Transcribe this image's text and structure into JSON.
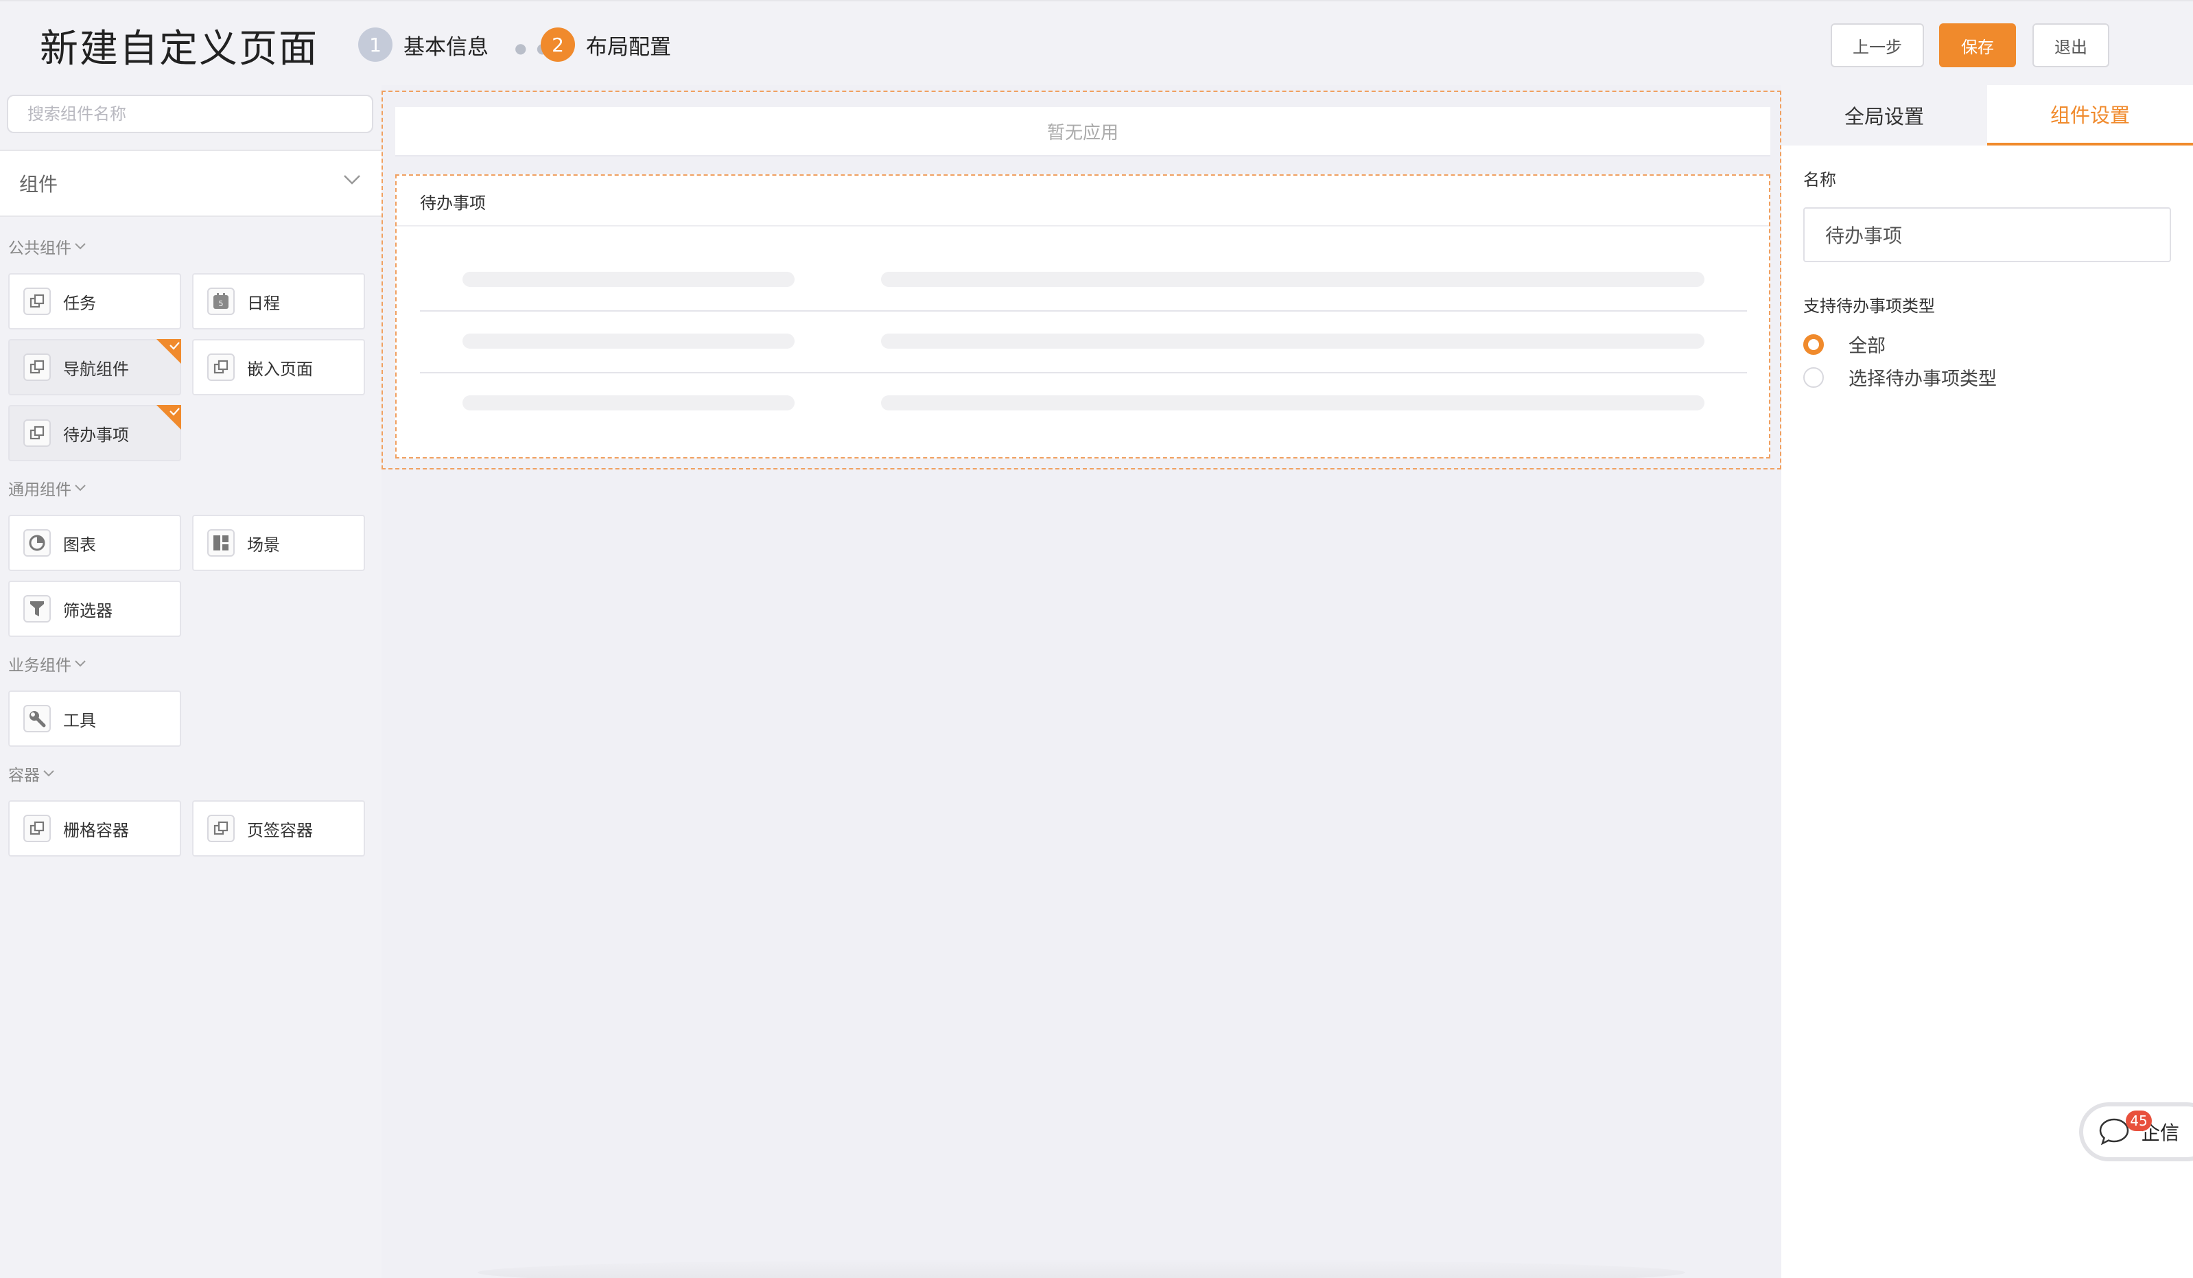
{
  "header": {
    "title": "新建自定义页面",
    "steps": [
      {
        "num": "1",
        "label": "基本信息"
      },
      {
        "num": "2",
        "label": "布局配置"
      }
    ],
    "buttons": {
      "prev": "上一步",
      "save": "保存",
      "exit": "退出"
    }
  },
  "sidebar": {
    "search_placeholder": "搜索组件名称",
    "select_label": "组件",
    "groups": [
      {
        "title": "公共组件",
        "items": [
          "任务",
          "日程",
          "导航组件",
          "嵌入页面",
          "待办事项"
        ]
      },
      {
        "title": "通用组件",
        "items": [
          "图表",
          "场景",
          "筛选器"
        ]
      },
      {
        "title": "业务组件",
        "items": [
          "工具"
        ]
      },
      {
        "title": "容器",
        "items": [
          "栅格容器",
          "页签容器"
        ]
      }
    ]
  },
  "canvas": {
    "no_app_text": "暂无应用",
    "todo_title": "待办事项"
  },
  "right_panel": {
    "tabs": [
      "全局设置",
      "组件设置"
    ],
    "name_label": "名称",
    "name_value": "待办事项",
    "type_label": "支持待办事项类型",
    "options": [
      "全部",
      "选择待办事项类型"
    ]
  },
  "chat": {
    "badge": "45",
    "label": "企信"
  },
  "colors": {
    "accent": "#f08a2c",
    "badge": "#e8503c"
  }
}
